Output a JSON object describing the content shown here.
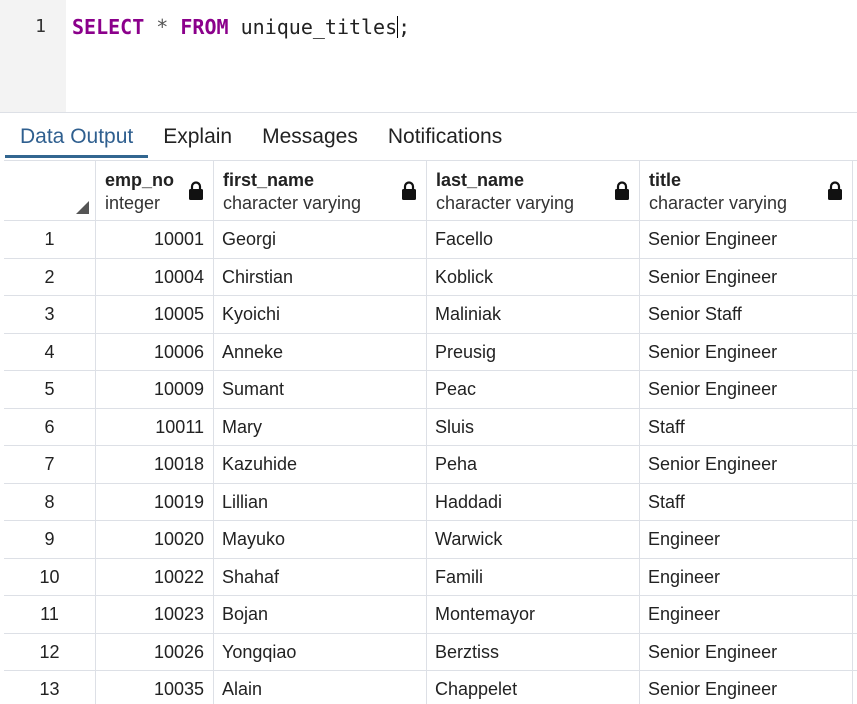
{
  "editor": {
    "line_number": "1",
    "tokens": {
      "select": "SELECT",
      "star": "*",
      "from": "FROM",
      "table": "unique_titles",
      "semicolon": ";"
    }
  },
  "tabs": [
    {
      "label": "Data Output",
      "active": true
    },
    {
      "label": "Explain",
      "active": false
    },
    {
      "label": "Messages",
      "active": false
    },
    {
      "label": "Notifications",
      "active": false
    }
  ],
  "columns": [
    {
      "name": "emp_no",
      "type": "integer"
    },
    {
      "name": "first_name",
      "type": "character varying"
    },
    {
      "name": "last_name",
      "type": "character varying"
    },
    {
      "name": "title",
      "type": "character varying"
    }
  ],
  "icons": {
    "lock": "lock-icon",
    "sort": "sort-corner-icon"
  },
  "colors": {
    "keyword": "#8b008b",
    "active_tab": "#326690",
    "grid_border": "#dde0e6"
  },
  "rows": [
    {
      "n": "1",
      "emp_no": "10001",
      "first_name": "Georgi",
      "last_name": "Facello",
      "title": "Senior Engineer"
    },
    {
      "n": "2",
      "emp_no": "10004",
      "first_name": "Chirstian",
      "last_name": "Koblick",
      "title": "Senior Engineer"
    },
    {
      "n": "3",
      "emp_no": "10005",
      "first_name": "Kyoichi",
      "last_name": "Maliniak",
      "title": "Senior Staff"
    },
    {
      "n": "4",
      "emp_no": "10006",
      "first_name": "Anneke",
      "last_name": "Preusig",
      "title": "Senior Engineer"
    },
    {
      "n": "5",
      "emp_no": "10009",
      "first_name": "Sumant",
      "last_name": "Peac",
      "title": "Senior Engineer"
    },
    {
      "n": "6",
      "emp_no": "10011",
      "first_name": "Mary",
      "last_name": "Sluis",
      "title": "Staff"
    },
    {
      "n": "7",
      "emp_no": "10018",
      "first_name": "Kazuhide",
      "last_name": "Peha",
      "title": "Senior Engineer"
    },
    {
      "n": "8",
      "emp_no": "10019",
      "first_name": "Lillian",
      "last_name": "Haddadi",
      "title": "Staff"
    },
    {
      "n": "9",
      "emp_no": "10020",
      "first_name": "Mayuko",
      "last_name": "Warwick",
      "title": "Engineer"
    },
    {
      "n": "10",
      "emp_no": "10022",
      "first_name": "Shahaf",
      "last_name": "Famili",
      "title": "Engineer"
    },
    {
      "n": "11",
      "emp_no": "10023",
      "first_name": "Bojan",
      "last_name": "Montemayor",
      "title": "Engineer"
    },
    {
      "n": "12",
      "emp_no": "10026",
      "first_name": "Yongqiao",
      "last_name": "Berztiss",
      "title": "Senior Engineer"
    },
    {
      "n": "13",
      "emp_no": "10035",
      "first_name": "Alain",
      "last_name": "Chappelet",
      "title": "Senior Engineer"
    }
  ]
}
